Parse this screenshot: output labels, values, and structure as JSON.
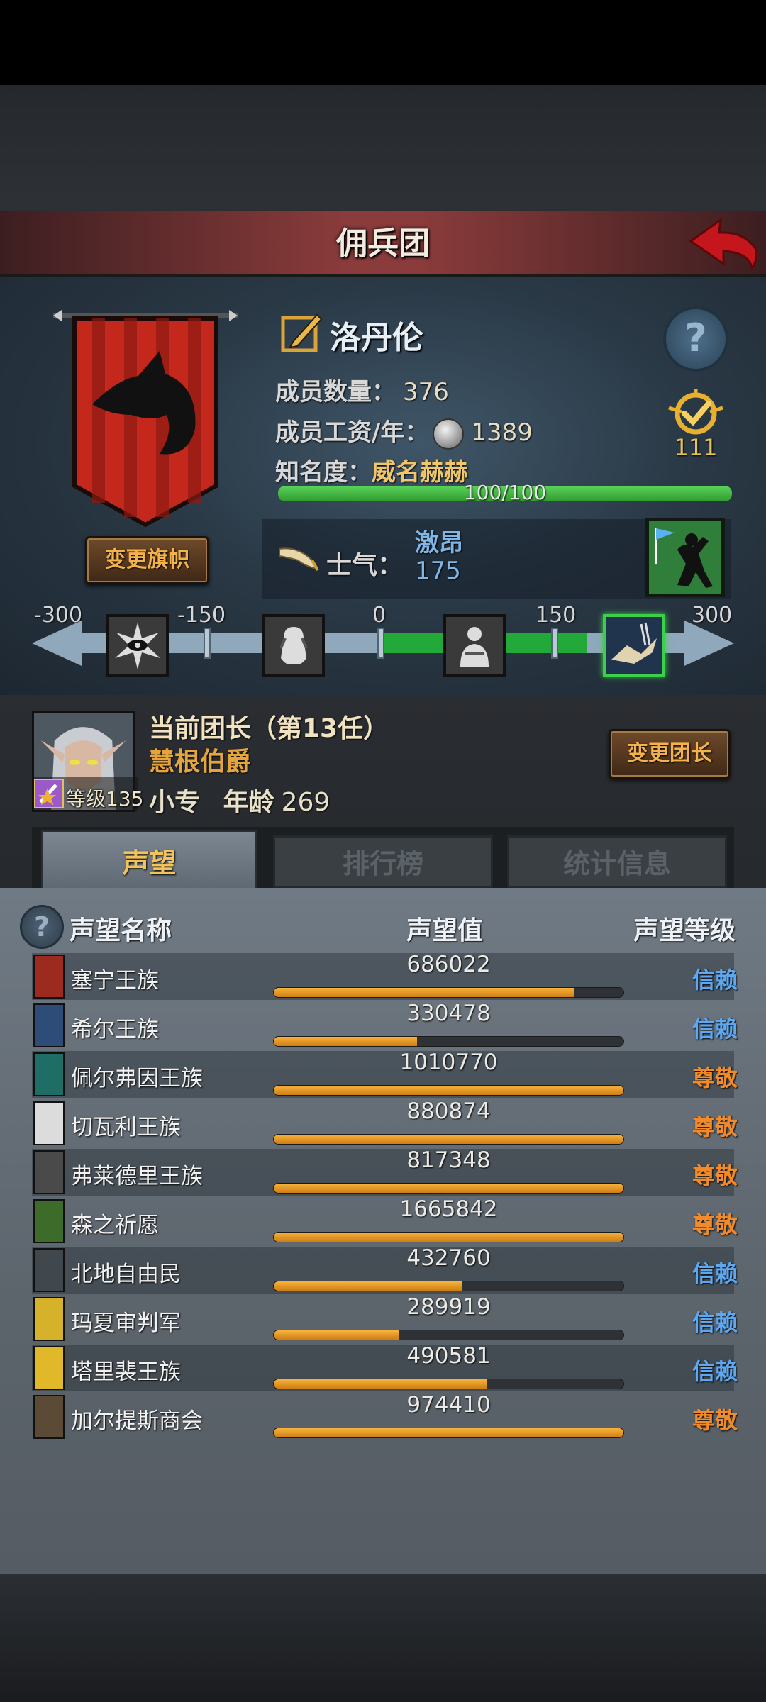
{
  "header": {
    "title": "佣兵团",
    "back_icon": "back-arrow-icon"
  },
  "guild": {
    "name": "洛丹伦",
    "member_count_label": "成员数量：",
    "member_count": "376",
    "salary_label": "成员工资/年：",
    "salary": "1389",
    "fame_label": "知名度：",
    "fame_value": "威名赫赫",
    "fame_progress_text": "100/100",
    "fame_progress": 1.0,
    "badge_count": "111",
    "change_banner_label": "变更旗帜",
    "help_icon": "?"
  },
  "morale": {
    "label": "士气：",
    "status": "激昂",
    "value": "175",
    "scale_labels": [
      "-300",
      "-150",
      "0",
      "150",
      "300"
    ]
  },
  "leader": {
    "title": "当前团长（第13任）",
    "name": "慧根伯爵",
    "specialty": "小专",
    "age_label": "年龄",
    "age": "269",
    "level_text": "等级135",
    "change_leader_label": "变更团长"
  },
  "tabs": [
    {
      "label": "声望",
      "active": true
    },
    {
      "label": "排行榜",
      "active": false
    },
    {
      "label": "统计信息",
      "active": false
    }
  ],
  "reputation": {
    "help_icon": "?",
    "col_name": "声望名称",
    "col_value": "声望值",
    "col_level": "声望等级",
    "rows": [
      {
        "name": "塞宁王族",
        "value": "686022",
        "fill": 0.86,
        "level": "信赖",
        "tier": "trust",
        "color": "#9c2a1f"
      },
      {
        "name": "希尔王族",
        "value": "330478",
        "fill": 0.41,
        "level": "信赖",
        "tier": "trust",
        "color": "#2d4d78"
      },
      {
        "name": "佩尔弗因王族",
        "value": "1010770",
        "fill": 1.0,
        "level": "尊敬",
        "tier": "revered",
        "color": "#1f6e66"
      },
      {
        "name": "切瓦利王族",
        "value": "880874",
        "fill": 1.0,
        "level": "尊敬",
        "tier": "revered",
        "color": "#dcdcdc"
      },
      {
        "name": "弗莱德里王族",
        "value": "817348",
        "fill": 1.0,
        "level": "尊敬",
        "tier": "revered",
        "color": "#4a4a4a"
      },
      {
        "name": "森之祈愿",
        "value": "1665842",
        "fill": 1.0,
        "level": "尊敬",
        "tier": "revered",
        "color": "#3c6b2a"
      },
      {
        "name": "北地自由民",
        "value": "432760",
        "fill": 0.54,
        "level": "信赖",
        "tier": "trust",
        "color": "#40484e"
      },
      {
        "name": "玛夏审判军",
        "value": "289919",
        "fill": 0.36,
        "level": "信赖",
        "tier": "trust",
        "color": "#d6b22a"
      },
      {
        "name": "塔里裴王族",
        "value": "490581",
        "fill": 0.61,
        "level": "信赖",
        "tier": "trust",
        "color": "#e0b82a"
      },
      {
        "name": "加尔提斯商会",
        "value": "974410",
        "fill": 1.0,
        "level": "尊敬",
        "tier": "revered",
        "color": "#5a4a36"
      }
    ]
  }
}
